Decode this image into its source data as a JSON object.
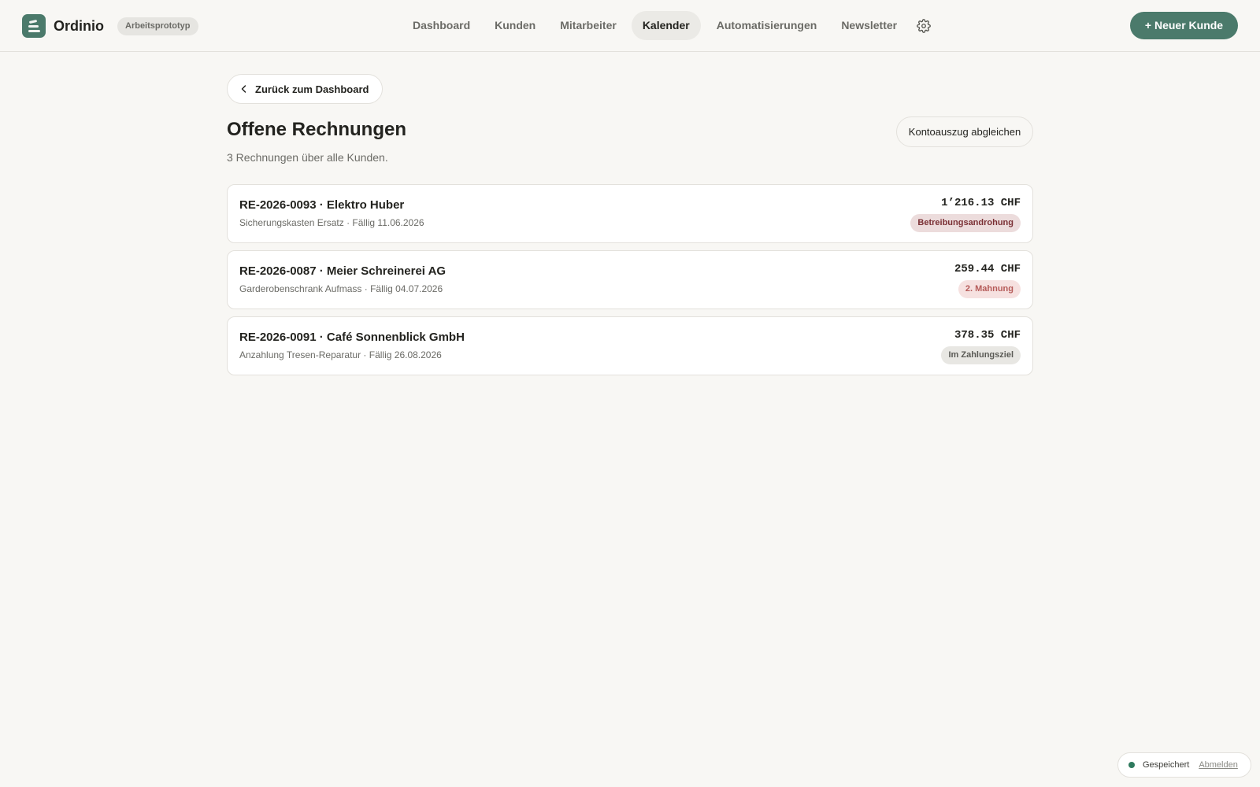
{
  "app": {
    "name": "Ordinio",
    "badge": "Arbeitsprototyp"
  },
  "nav": {
    "items": [
      {
        "label": "Dashboard",
        "active": false
      },
      {
        "label": "Kunden",
        "active": false
      },
      {
        "label": "Mitarbeiter",
        "active": false
      },
      {
        "label": "Kalender",
        "active": true
      },
      {
        "label": "Automatisierungen",
        "active": false
      },
      {
        "label": "Newsletter",
        "active": false
      }
    ],
    "settings_icon": "gear-icon"
  },
  "header": {
    "new_customer_label": "+ Neuer Kunde"
  },
  "page": {
    "back_label": "Zurück zum Dashboard",
    "title": "Offene Rechnungen",
    "subtitle": "3 Rechnungen über alle Kunden.",
    "reconcile_label": "Kontoauszug abgleichen"
  },
  "invoices": [
    {
      "title": "RE-2026-0093 · Elektro Huber",
      "subtitle": "Sicherungskasten Ersatz · Fällig 11.06.2026",
      "amount": "1’216.13 CHF",
      "status": "Betreibungsandrohung",
      "status_bg": "#ecdcdc",
      "status_color": "#7a2f34"
    },
    {
      "title": "RE-2026-0087 · Meier Schreinerei AG",
      "subtitle": "Garderobenschrank Aufmass · Fällig 04.07.2026",
      "amount": "259.44 CHF",
      "status": "2. Mahnung",
      "status_bg": "#f6e1e0",
      "status_color": "#b55a58"
    },
    {
      "title": "RE-2026-0091 · Café Sonnenblick GmbH",
      "subtitle": "Anzahlung Tresen-Reparatur · Fällig 26.08.2026",
      "amount": "378.35 CHF",
      "status": "Im Zahlungsziel",
      "status_bg": "#e8e7e3",
      "status_color": "#5a5a55"
    }
  ],
  "status_bar": {
    "saved_label": "Gespeichert",
    "logout_label": "Abmelden"
  },
  "colors": {
    "accent": "#4b7a6b",
    "background": "#f8f7f4",
    "saved_dot": "#2f7a5e"
  }
}
